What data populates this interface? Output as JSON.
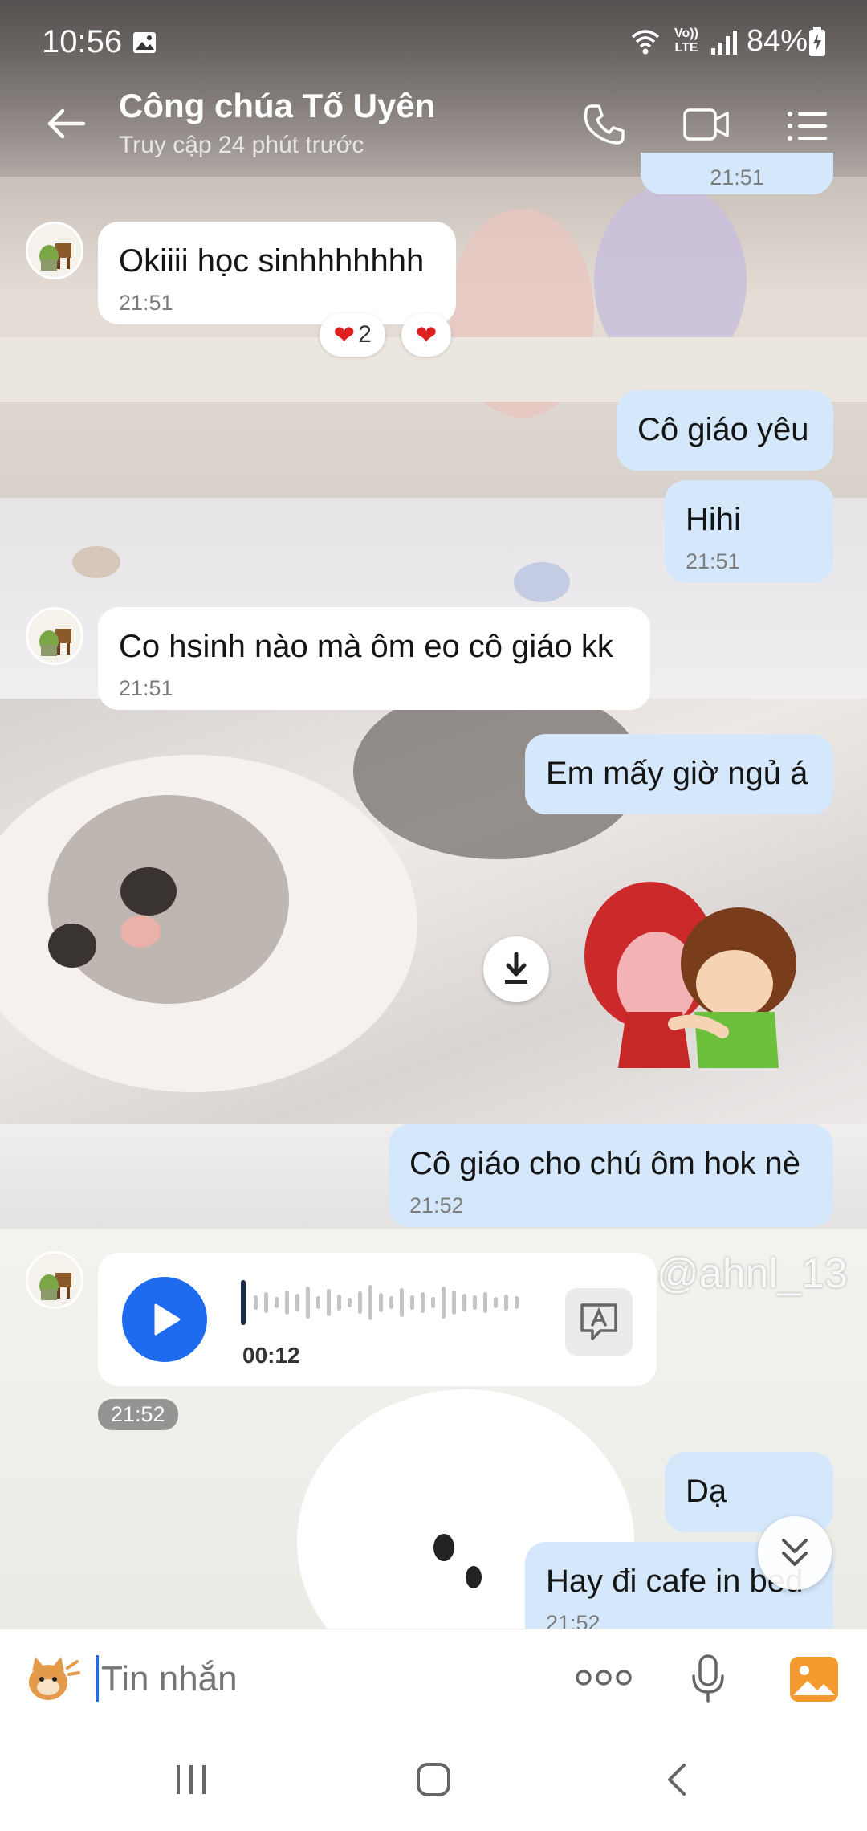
{
  "status_bar": {
    "time": "10:56",
    "battery": "84%",
    "network": "LTE",
    "icons": [
      "image-icon",
      "wifi-icon",
      "volte-icon",
      "signal-icon",
      "battery-icon"
    ]
  },
  "header": {
    "contact_name": "Công chúa Tố Uyên",
    "last_seen": "Truy cập 24 phút trước",
    "icons": [
      "back-arrow-icon",
      "phone-icon",
      "video-call-icon",
      "menu-icon"
    ]
  },
  "messages": {
    "top_time": "21:51",
    "m1": {
      "text": "Okiiii học sinhhhhhhh",
      "time": "21:51",
      "reaction_count": "2"
    },
    "m2": {
      "text": "Cô giáo yêu"
    },
    "m3": {
      "text": "Hihi",
      "time": "21:51"
    },
    "m4": {
      "text": "Co hsinh nào mà ôm eo cô giáo kk",
      "time": "21:51"
    },
    "m5": {
      "text": "Em mấy giờ ngủ á"
    },
    "m6": {
      "text": "Cô giáo cho chú ôm hok nè",
      "time": "21:52"
    },
    "voice": {
      "duration": "00:12",
      "time": "21:52"
    },
    "m7": {
      "text": "Dạ"
    },
    "m8": {
      "text": "Hay đi cafe in bed",
      "time": "21:52"
    }
  },
  "watermark": "@ahnl_13",
  "composer": {
    "placeholder": "Tin nhắn",
    "icons": [
      "sticker-icon",
      "more-icon",
      "microphone-icon",
      "gallery-icon"
    ]
  },
  "colors": {
    "accent": "#1f6bf0",
    "outgoing_bubble": "#d5e8fb",
    "incoming_bubble": "#ffffff"
  }
}
